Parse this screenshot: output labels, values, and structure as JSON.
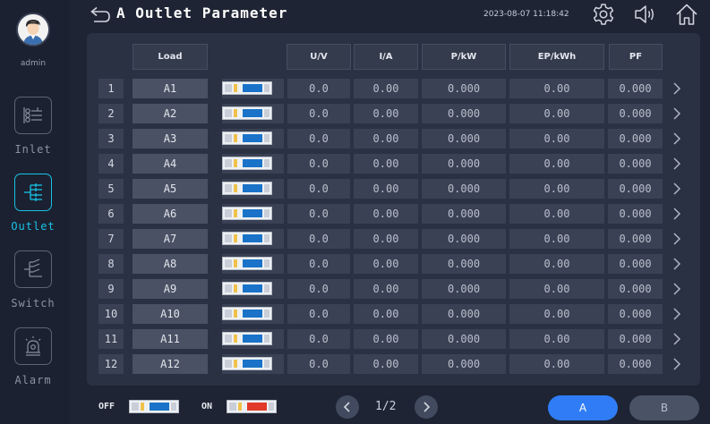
{
  "sidebar": {
    "user": "admin",
    "items": [
      {
        "label": "Inlet",
        "icon": "inlet-icon",
        "active": false
      },
      {
        "label": "Outlet",
        "icon": "outlet-icon",
        "active": true
      },
      {
        "label": "Switch",
        "icon": "switch-icon",
        "active": false
      },
      {
        "label": "Alarm",
        "icon": "alarm-icon",
        "active": false
      }
    ]
  },
  "header": {
    "title": "A Outlet Parameter",
    "datetime": "2023-08-07 11:18:42",
    "icons": [
      "back-arrow-icon",
      "gear-icon",
      "speaker-icon",
      "home-icon"
    ]
  },
  "table": {
    "columns": {
      "load": "Load",
      "u": "U/V",
      "i": "I/A",
      "p": "P/kW",
      "ep": "EP/kWh",
      "pf": "PF"
    },
    "rows": [
      {
        "num": "1",
        "load": "A1",
        "u": "0.0",
        "i": "0.00",
        "p": "0.000",
        "ep": "0.00",
        "pf": "0.000",
        "state": "off"
      },
      {
        "num": "2",
        "load": "A2",
        "u": "0.0",
        "i": "0.00",
        "p": "0.000",
        "ep": "0.00",
        "pf": "0.000",
        "state": "off"
      },
      {
        "num": "3",
        "load": "A3",
        "u": "0.0",
        "i": "0.00",
        "p": "0.000",
        "ep": "0.00",
        "pf": "0.000",
        "state": "off"
      },
      {
        "num": "4",
        "load": "A4",
        "u": "0.0",
        "i": "0.00",
        "p": "0.000",
        "ep": "0.00",
        "pf": "0.000",
        "state": "off"
      },
      {
        "num": "5",
        "load": "A5",
        "u": "0.0",
        "i": "0.00",
        "p": "0.000",
        "ep": "0.00",
        "pf": "0.000",
        "state": "off"
      },
      {
        "num": "6",
        "load": "A6",
        "u": "0.0",
        "i": "0.00",
        "p": "0.000",
        "ep": "0.00",
        "pf": "0.000",
        "state": "off"
      },
      {
        "num": "7",
        "load": "A7",
        "u": "0.0",
        "i": "0.00",
        "p": "0.000",
        "ep": "0.00",
        "pf": "0.000",
        "state": "off"
      },
      {
        "num": "8",
        "load": "A8",
        "u": "0.0",
        "i": "0.00",
        "p": "0.000",
        "ep": "0.00",
        "pf": "0.000",
        "state": "off"
      },
      {
        "num": "9",
        "load": "A9",
        "u": "0.0",
        "i": "0.00",
        "p": "0.000",
        "ep": "0.00",
        "pf": "0.000",
        "state": "off"
      },
      {
        "num": "10",
        "load": "A10",
        "u": "0.0",
        "i": "0.00",
        "p": "0.000",
        "ep": "0.00",
        "pf": "0.000",
        "state": "off"
      },
      {
        "num": "11",
        "load": "A11",
        "u": "0.0",
        "i": "0.00",
        "p": "0.000",
        "ep": "0.00",
        "pf": "0.000",
        "state": "off"
      },
      {
        "num": "12",
        "load": "A12",
        "u": "0.0",
        "i": "0.00",
        "p": "0.000",
        "ep": "0.00",
        "pf": "0.000",
        "state": "off"
      }
    ]
  },
  "footer": {
    "off_label": "OFF",
    "on_label": "ON",
    "page": "1/2",
    "phases": [
      {
        "label": "A",
        "active": true
      },
      {
        "label": "B",
        "active": false
      }
    ]
  },
  "colors": {
    "background": "#1e2433",
    "panel": "#2a3142",
    "accent": "#19c2e8",
    "button_active": "#2f7cf6",
    "switch_off_knob": "#1a73c8",
    "switch_on_knob": "#e23a2a"
  }
}
